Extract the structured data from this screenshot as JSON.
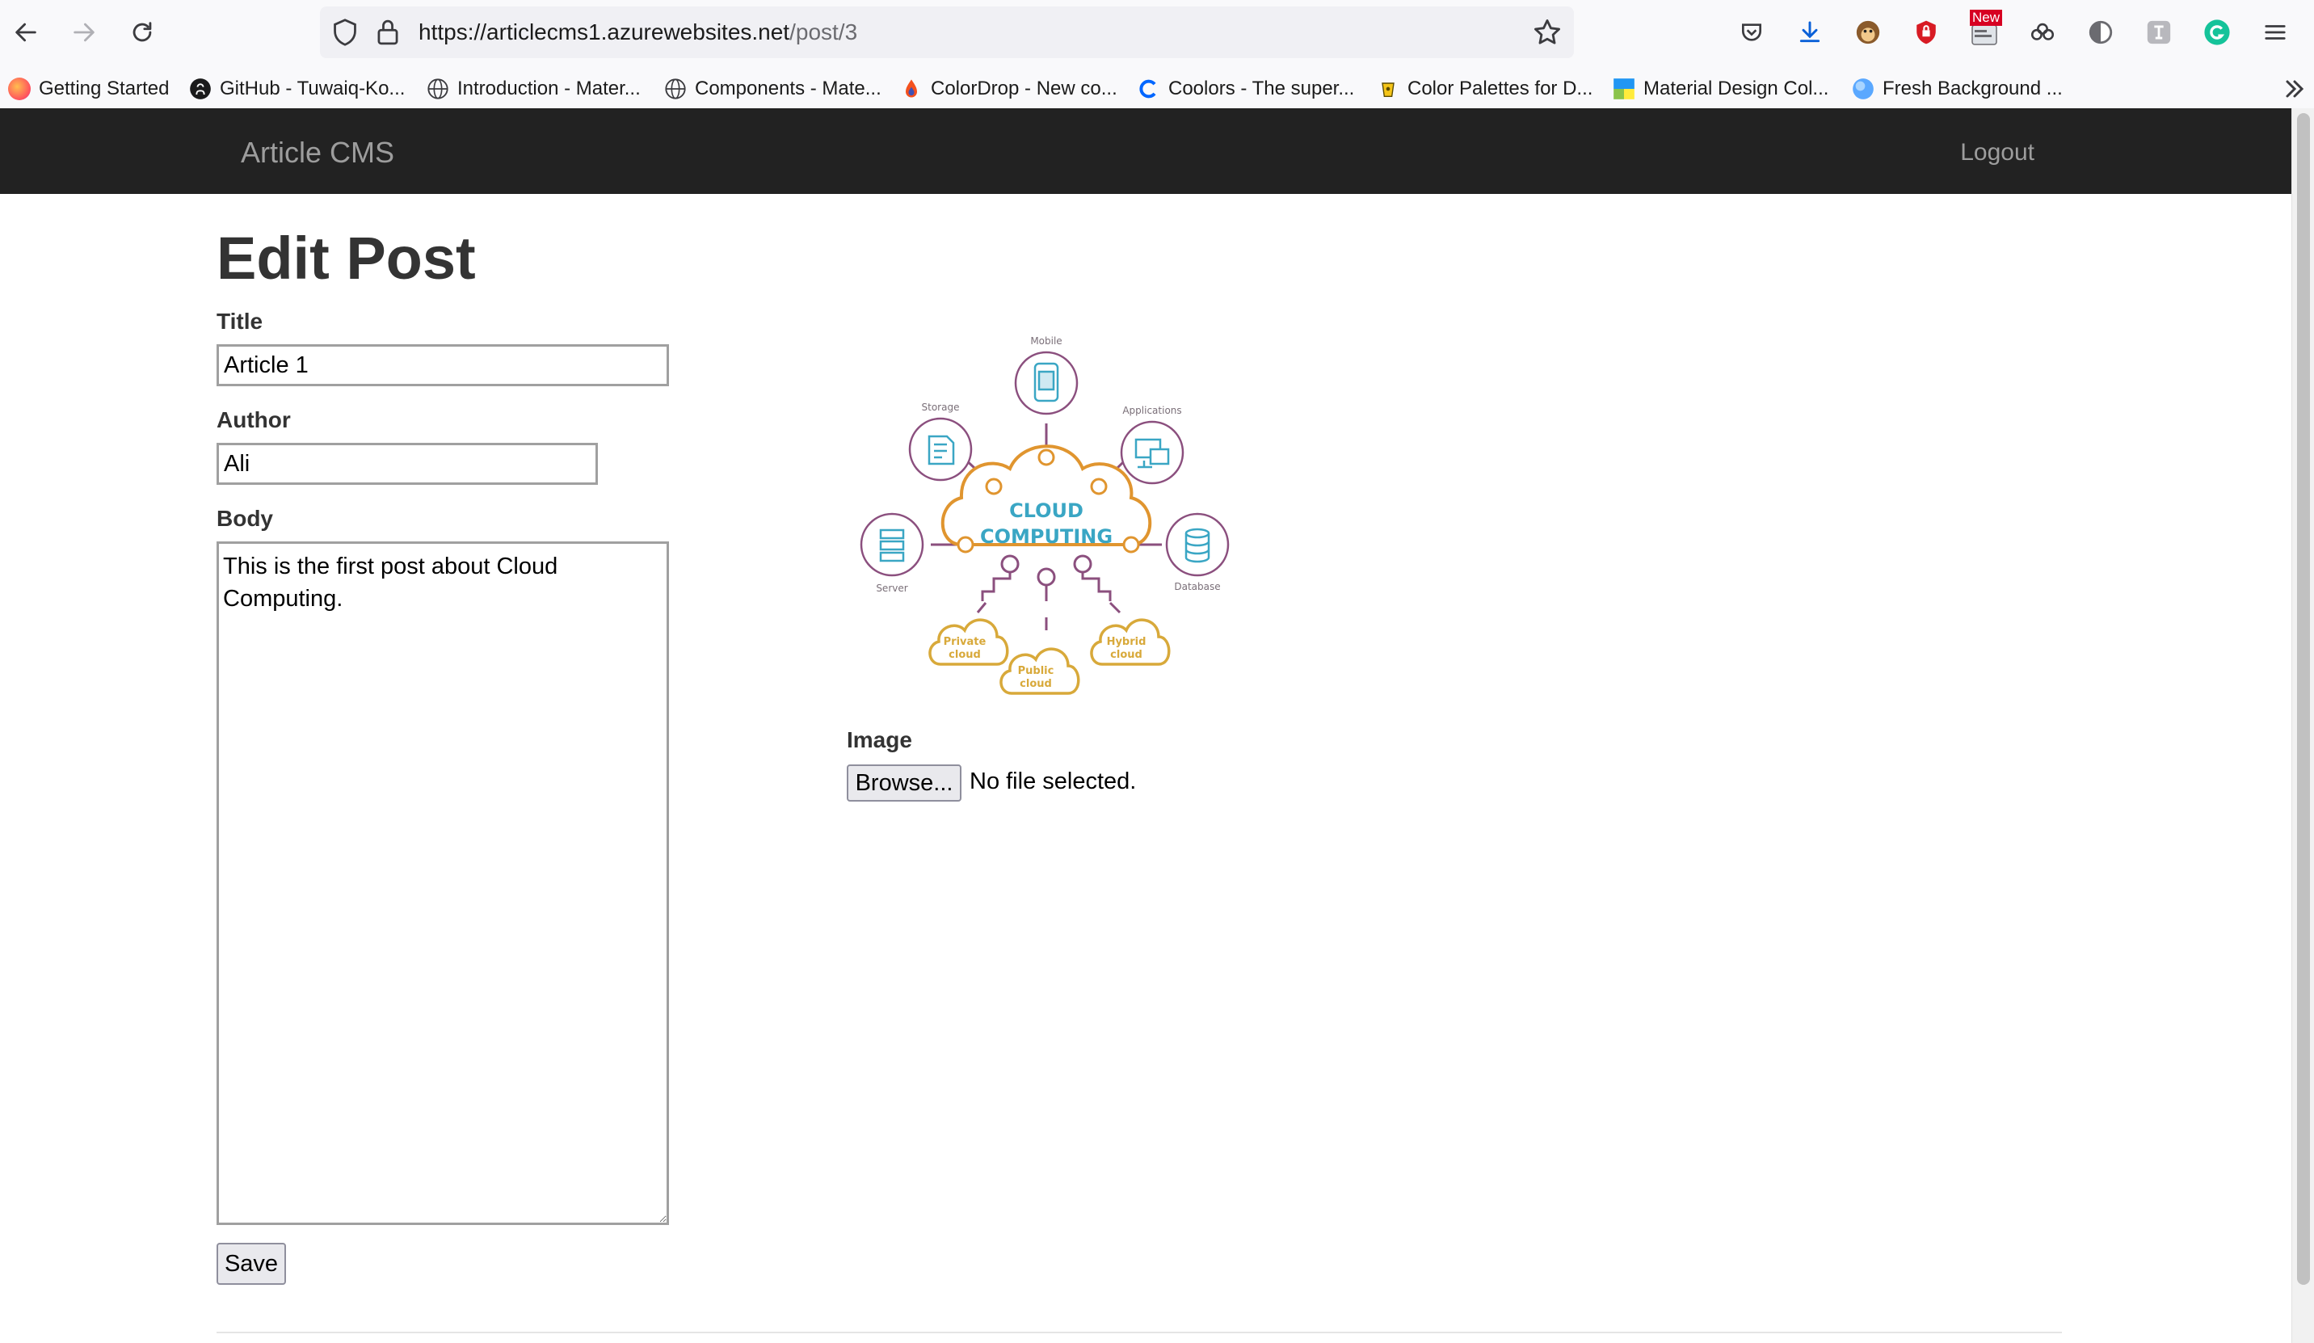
{
  "browser": {
    "url_host": "https://articlecms1.azurewebsites.net",
    "url_path": "/post/3",
    "extensions": [
      "pocket-icon",
      "download-icon",
      "monkey-extension-icon",
      "ublock-shield-icon",
      "news-extension-icon",
      "cloud-sync-icon",
      "shadow-extension-icon",
      "translate-extension-icon",
      "grammarly-icon",
      "hamburger-menu-icon"
    ],
    "extension_badge": "New",
    "bookmarks": [
      "Getting Started",
      "GitHub - Tuwaiq-Ko...",
      "Introduction - Mater...",
      "Components - Mate...",
      "ColorDrop - New co...",
      "Coolors - The super...",
      "Color Palettes for D...",
      "Material Design Col...",
      "Fresh Background ..."
    ]
  },
  "site": {
    "brand": "Article CMS",
    "logout": "Logout"
  },
  "form": {
    "heading": "Edit Post",
    "title_label": "Title",
    "title_value": "Article 1",
    "author_label": "Author",
    "author_value": "Ali",
    "body_label": "Body",
    "body_value": "This is the first post about Cloud Computing.",
    "save_label": "Save",
    "image_label": "Image",
    "browse_label": "Browse...",
    "no_file_text": "No file selected."
  },
  "image": {
    "center_line1": "CLOUD",
    "center_line2": "COMPUTING",
    "nodes": [
      "Mobile",
      "Applications",
      "Database",
      "Server",
      "Storage"
    ],
    "clouds": [
      [
        "Private",
        "cloud"
      ],
      [
        "Public",
        "cloud"
      ],
      [
        "Hybrid",
        "cloud"
      ]
    ]
  },
  "colors": {
    "navbar_bg": "#222222",
    "navbar_text": "#9d9d9d",
    "cloud_orange": "#e0952f",
    "cloud_teal": "#3aa6c4",
    "node_purple": "#8b4f7e",
    "cloud_gold": "#d8a93a"
  }
}
